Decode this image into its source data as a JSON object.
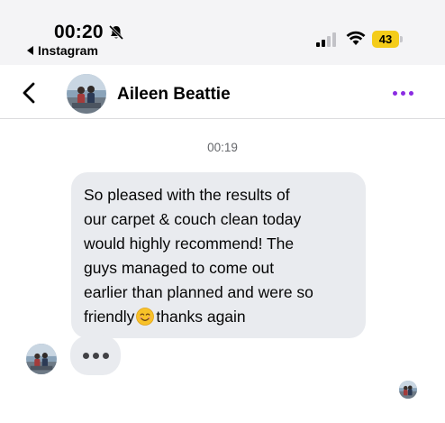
{
  "status_bar": {
    "time": "00:20",
    "back_app_label": "Instagram",
    "battery_level": "43",
    "icons": [
      "bell-slash-icon",
      "cellular-signal-icon",
      "wifi-icon",
      "battery-icon"
    ]
  },
  "header": {
    "contact_name": "Aileen Beattie",
    "back_icon": "chevron-left-icon",
    "more_icon": "more-dots-icon",
    "accent_color": "#8a2be2"
  },
  "chat": {
    "timestamp": "00:19",
    "message_lines": [
      "So pleased with the results of",
      "our carpet & couch clean today",
      "would highly recommend! The",
      "guys managed to come out",
      "earlier than planned and were so",
      "friendly",
      "thanks again"
    ],
    "emoji_icon": "smiling-face-emoji",
    "typing_indicator_icon": "typing-dots-icon",
    "bubble_color": "#e9ebef"
  }
}
